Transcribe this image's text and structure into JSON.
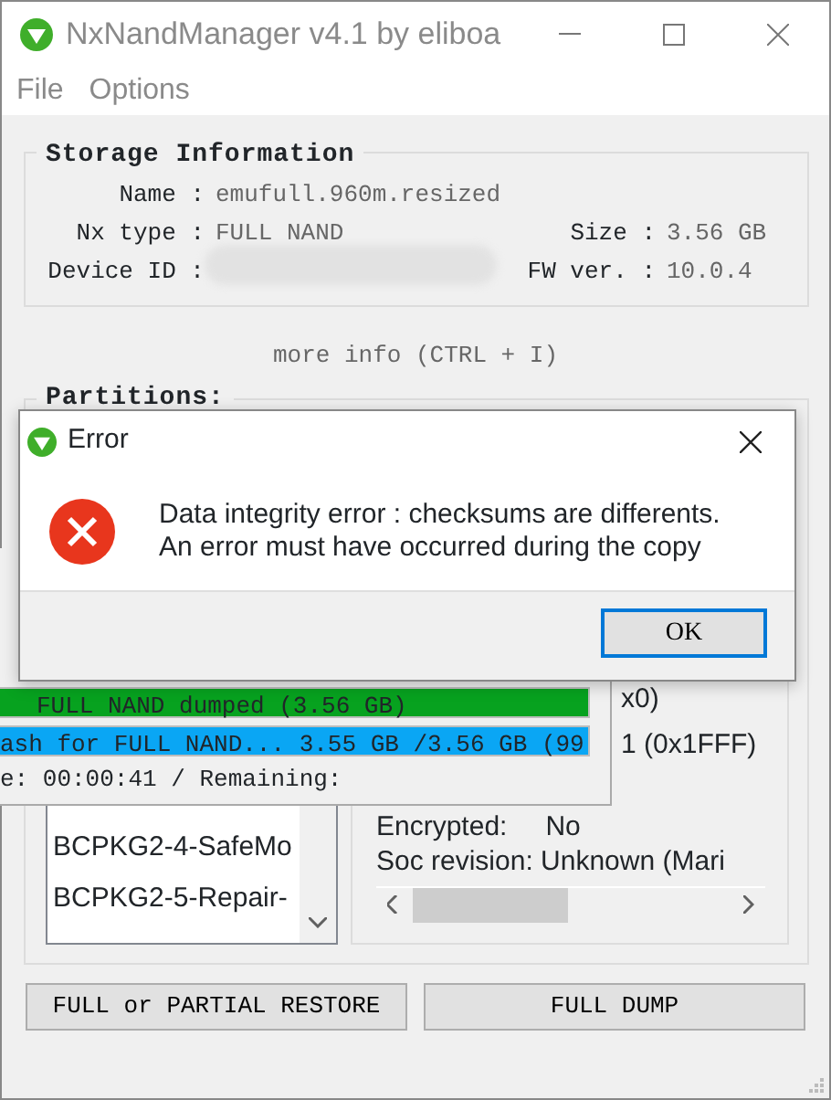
{
  "window": {
    "title": "NxNandManager v4.1 by eliboa",
    "menu": [
      "File",
      "Options"
    ]
  },
  "storage": {
    "title": "Storage Information",
    "rows": [
      {
        "label": "Name :",
        "value": "emufull.960m.resized"
      },
      {
        "label": "Nx type :",
        "value": "FULL NAND",
        "label_2": "Size :",
        "value_2": "3.56 GB"
      },
      {
        "label": "Device ID :",
        "redacted": true,
        "label_2": "FW ver. :",
        "value_2": "10.0.4"
      }
    ]
  },
  "more_info": "more info (CTRL + I)",
  "partitions": {
    "title": "Partitions:",
    "items": [
      "BCPKG2-4-SafeMo",
      "BCPKG2-5-Repair-"
    ],
    "details": [
      "x0)",
      "1 (0x1FFF)"
    ],
    "encrypted": {
      "label": "Encrypted:",
      "value": "No"
    },
    "soc": "Soc revision: Unknown (Mari"
  },
  "buttons": [
    "FULL or PARTIAL RESTORE",
    "FULL DUMP"
  ],
  "progress_window": {
    "bars": [
      {
        "text": "FULL NAND dumped (3.56 GB)",
        "level": 1,
        "color": "#07a21f"
      },
      {
        "text": "ash for FULL NAND... 3.55 GB /3.56 GB (99",
        "level": 1,
        "color": "#0aa6f4"
      }
    ],
    "status": "e: 00:00:41 / Remaining:"
  },
  "error_dialog": {
    "title": "Error",
    "message": [
      "Data integrity error : checksums are differents.",
      "An error must have occurred during the copy"
    ],
    "button": "OK"
  }
}
